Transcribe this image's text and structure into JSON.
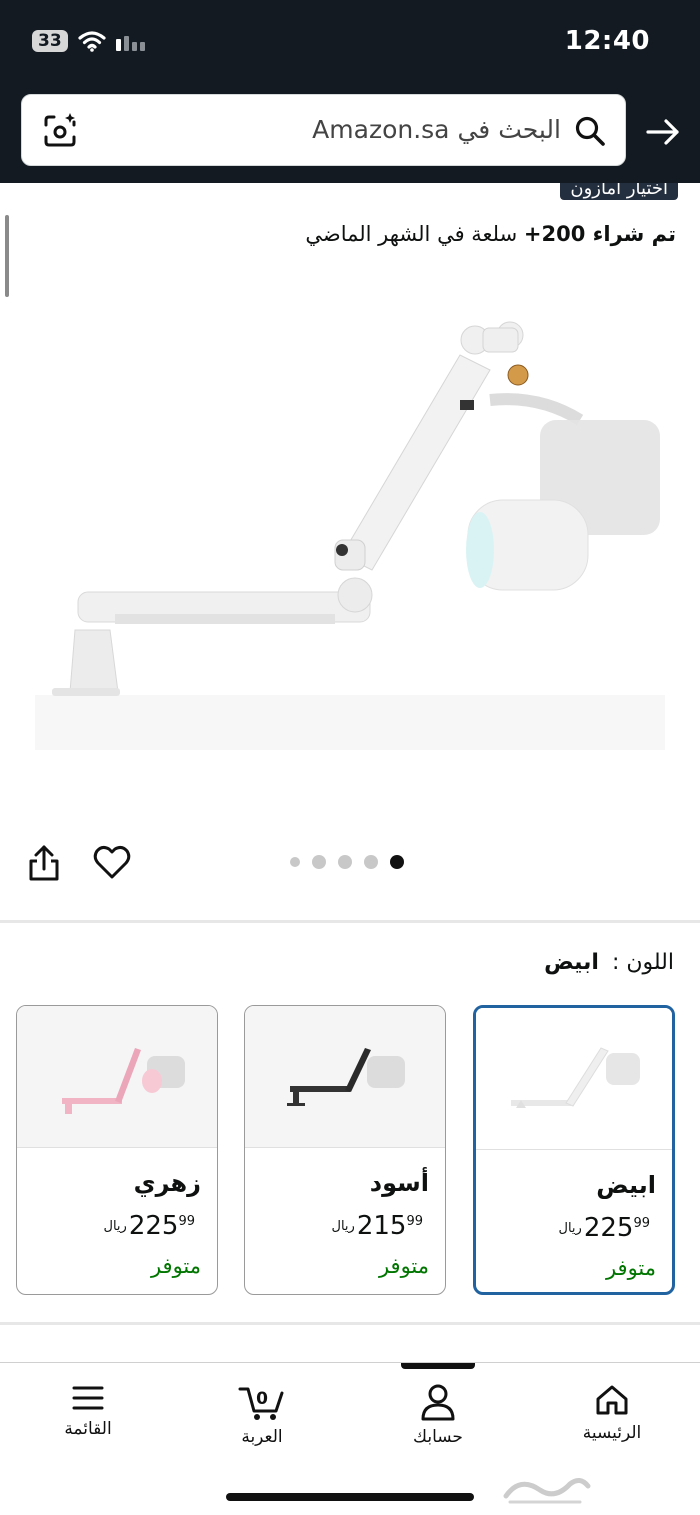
{
  "status_bar": {
    "time": "12:40",
    "battery": "33"
  },
  "search": {
    "placeholder": "البحث في Amazon.sa"
  },
  "product": {
    "badge": "اختيار أمازون",
    "bought_bold": "تم شراء 200+",
    "bought_rest": "سلعة في الشهر الماضي",
    "image_count": 5,
    "active_image": 5
  },
  "variation": {
    "label": "اللون :",
    "selected": "ابيض",
    "options": [
      {
        "name": "ابيض",
        "whole": "225",
        "fraction": "99",
        "currency": "ريال",
        "availability": "متوفر",
        "color": "#f2f2f2",
        "selected": true
      },
      {
        "name": "أسود",
        "whole": "215",
        "fraction": "99",
        "currency": "ريال",
        "availability": "متوفر",
        "color": "#333333",
        "selected": false
      },
      {
        "name": "زهري",
        "whole": "225",
        "fraction": "99",
        "currency": "ريال",
        "availability": "متوفر",
        "color": "#f0b4c4",
        "selected": false
      }
    ]
  },
  "nav": {
    "home": "الرئيسية",
    "account": "حسابك",
    "cart": "العربة",
    "cart_count": "0",
    "menu": "القائمة"
  },
  "colors": {
    "header_bg": "#131a22",
    "selected_border": "#2162a1",
    "in_stock": "#007600"
  }
}
